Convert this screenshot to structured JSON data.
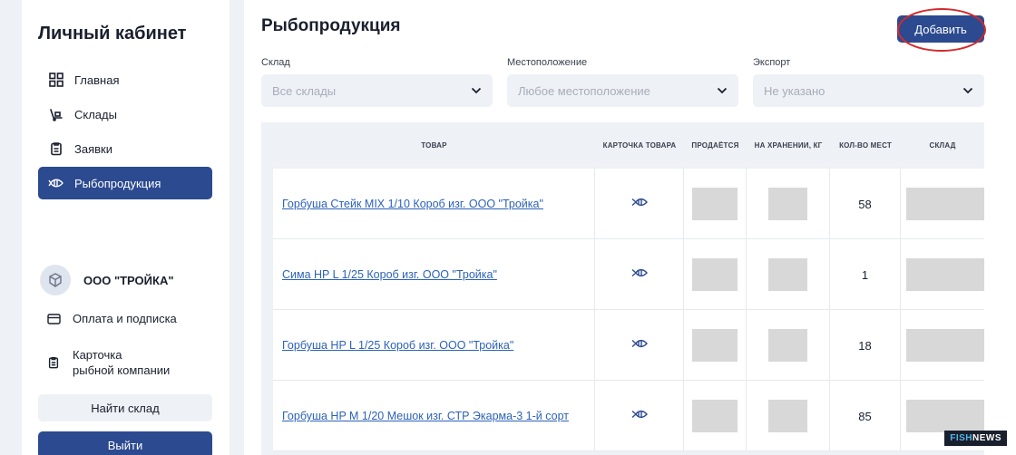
{
  "sidebar": {
    "title": "Личный кабинет",
    "nav": [
      {
        "label": "Главная",
        "icon": "grid-icon"
      },
      {
        "label": "Склады",
        "icon": "warehouse-icon"
      },
      {
        "label": "Заявки",
        "icon": "clipboard-icon"
      },
      {
        "label": "Рыбопродукция",
        "icon": "fish-icon",
        "active": true
      }
    ],
    "company_name": "ООО \"ТРОЙКА\"",
    "company_links": [
      {
        "label": "Оплата и подписка",
        "icon": "card-icon"
      },
      {
        "label_line1": "Карточка",
        "label_line2": "рыбной компании",
        "icon": "clipboard-icon"
      }
    ],
    "find_warehouse": "Найти склад",
    "logout": "Выйти"
  },
  "main": {
    "title": "Рыбопродукция",
    "add_button": "Добавить",
    "filters": [
      {
        "label": "Склад",
        "value": "Все склады"
      },
      {
        "label": "Местоположение",
        "value": "Любое местоположение"
      },
      {
        "label": "Экспорт",
        "value": "Не указано"
      }
    ],
    "table": {
      "headers": [
        "ТОВАР",
        "КАРТОЧКА ТОВАРА",
        "ПРОДАЁТСЯ",
        "НА ХРАНЕНИИ, КГ",
        "КОЛ-ВО МЕСТ",
        "СКЛАД"
      ],
      "rows": [
        {
          "product": "Горбуша Стейк MIX 1/10 Короб изг. ООО \"Тройка\"",
          "places": "58"
        },
        {
          "product": "Сима HP L 1/25 Короб изг. ООО \"Тройка\"",
          "places": "1"
        },
        {
          "product": "Горбуша HP L 1/25 Короб изг. ООО \"Тройка\"",
          "places": "18"
        },
        {
          "product": "Горбуша HP M 1/20 Мешок изг. СТР Экарма-3 1-й сорт",
          "places": "85"
        }
      ]
    }
  },
  "watermark": {
    "part1": "FISH",
    "part2": "NEWS"
  },
  "colors": {
    "accent": "#2c4a8f",
    "link": "#2c62b8",
    "highlight": "#d42a2a"
  }
}
